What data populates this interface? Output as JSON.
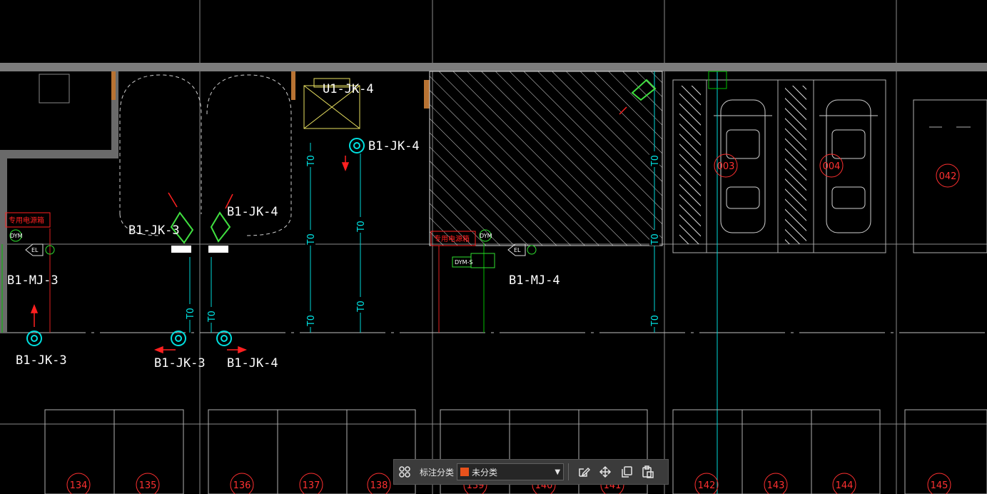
{
  "drawing": {
    "labels": {
      "cam_b1_jk_4_top_label": "B1-JK-4",
      "u1_jk_4_label": "U1-JK-4",
      "b1_jk_3_left_label": "B1-JK-3",
      "b1_jk_4_mid_label": "B1-JK-4",
      "b1_mj_3_label": "B1-MJ-3",
      "b1_mj_4_label": "B1-MJ-4",
      "b1_jk_3_bottom_left_label": "B1-JK-3",
      "b1_jk_3_bottom_label": "B1-JK-3",
      "b1_jk_4_bottom_label": "B1-JK-4"
    },
    "power_box_left": "专用电源箱",
    "power_box_right": "专用电源箱",
    "to_tag": "TO",
    "el_tag": "EL",
    "dym_tag": "DYM",
    "cable_tag": "DYM-S",
    "spaces_top": [
      "003",
      "004",
      "042"
    ],
    "spaces_bottom": [
      "134",
      "135",
      "136",
      "137",
      "138",
      "139",
      "140",
      "141",
      "142",
      "143",
      "144",
      "145"
    ]
  },
  "toolbar": {
    "grid_icon": "grid-icon",
    "category_label": "标注分类",
    "category_value": "未分类",
    "category_color": "#e8521c",
    "icons": [
      "edit-icon",
      "move-icon",
      "copy-icon",
      "paste-icon"
    ]
  }
}
